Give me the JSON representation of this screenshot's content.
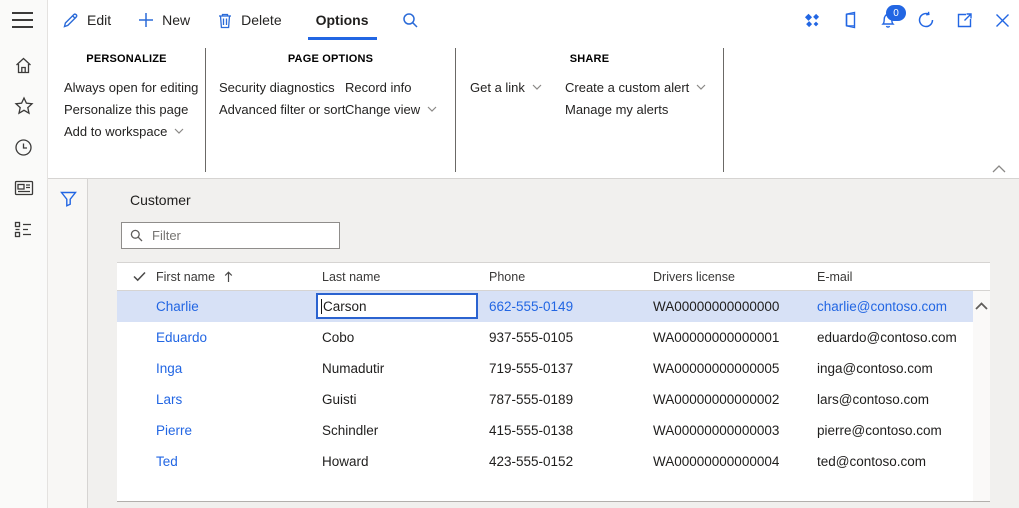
{
  "colors": {
    "accent": "#2266e3",
    "selected_row_bg": "#d7e1f6",
    "workspace_bg": "#f1f0ee"
  },
  "left_nav": {
    "icons": [
      "menu",
      "home",
      "favorites",
      "recent",
      "workspaces",
      "modules"
    ]
  },
  "command_bar": {
    "edit_label": "Edit",
    "new_label": "New",
    "delete_label": "Delete",
    "options_label": "Options",
    "notification_count": "0",
    "right_icons": [
      "flighting",
      "dynamics",
      "notifications",
      "refresh",
      "open-in-new-window",
      "close"
    ]
  },
  "ribbon": {
    "personalize": {
      "title": "PERSONALIZE",
      "items": [
        "Always open for editing",
        "Personalize this page",
        "Add to workspace"
      ]
    },
    "page_options": {
      "title": "PAGE OPTIONS",
      "col1": [
        "Security diagnostics",
        "Advanced filter or sort"
      ],
      "col2": [
        "Record info",
        "Change view"
      ]
    },
    "share": {
      "title": "SHARE",
      "col1": [
        "Get a link"
      ],
      "col2": [
        "Create a custom alert",
        "Manage my alerts"
      ]
    }
  },
  "content": {
    "title": "Customer",
    "filter_placeholder": "Filter",
    "grid": {
      "columns": [
        "First name",
        "Last name",
        "Phone",
        "Drivers license",
        "E-mail"
      ],
      "sorted_column": "First name",
      "sort_direction": "ascending",
      "rows": [
        {
          "first": "Charlie",
          "last": "Carson",
          "phone": "662-555-0149",
          "license": "WA00000000000000",
          "email": "charlie@contoso.com"
        },
        {
          "first": "Eduardo",
          "last": "Cobo",
          "phone": "937-555-0105",
          "license": "WA00000000000001",
          "email": "eduardo@contoso.com"
        },
        {
          "first": "Inga",
          "last": "Numadutir",
          "phone": "719-555-0137",
          "license": "WA00000000000005",
          "email": "inga@contoso.com"
        },
        {
          "first": "Lars",
          "last": "Guisti",
          "phone": "787-555-0189",
          "license": "WA00000000000002",
          "email": "lars@contoso.com"
        },
        {
          "first": "Pierre",
          "last": "Schindler",
          "phone": "415-555-0138",
          "license": "WA00000000000003",
          "email": "pierre@contoso.com"
        },
        {
          "first": "Ted",
          "last": "Howard",
          "phone": "423-555-0152",
          "license": "WA00000000000004",
          "email": "ted@contoso.com"
        }
      ]
    }
  }
}
